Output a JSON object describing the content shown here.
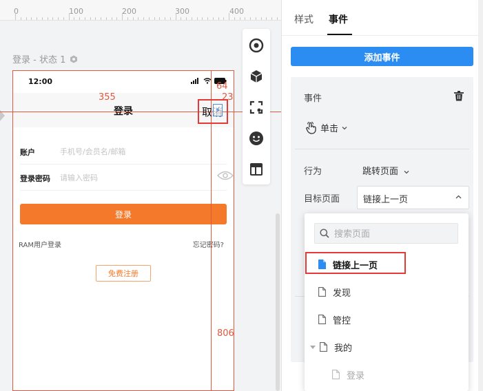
{
  "ruler": {
    "labels": [
      "0",
      "100",
      "200",
      "300",
      "400"
    ]
  },
  "canvas": {
    "page_caption": "登录 - 状态 1",
    "measure_top": "355",
    "measure_right_a": "64",
    "measure_right_b": "23",
    "measure_bottom": "806",
    "cancel_text": "取消"
  },
  "phone": {
    "status_time": "12:00",
    "nav_title": "登录",
    "account_label": "账户",
    "account_placeholder": "手机号/会员名/邮箱",
    "password_label": "登录密码",
    "password_placeholder": "请输入密码",
    "login_button": "登录",
    "ram_link": "RAM用户登录",
    "forgot_link": "忘记密码?",
    "register_button": "免费注册",
    "accent_color": "#f5792a"
  },
  "toolbar": {
    "items": [
      "target-icon",
      "cube-icon",
      "scan-icon",
      "smiley-icon",
      "layout-icon"
    ]
  },
  "panel": {
    "tabs": [
      {
        "label": "样式",
        "active": false
      },
      {
        "label": "事件",
        "active": true
      }
    ],
    "add_event_button": "添加事件",
    "event_label": "事件",
    "trigger_value": "单击",
    "behavior_label": "行为",
    "behavior_value": "跳转页面",
    "target_label": "目标页面",
    "target_value": "链接上一页",
    "primary_color": "#2b8cf2"
  },
  "dropdown": {
    "search_placeholder": "搜索页面",
    "items": [
      {
        "label": "链接上一页",
        "selected": true
      },
      {
        "label": "发现",
        "selected": false
      },
      {
        "label": "管控",
        "selected": false
      },
      {
        "label": "我的",
        "selected": false,
        "expandable": true
      },
      {
        "label": "登录",
        "selected": false,
        "child": true
      }
    ]
  }
}
